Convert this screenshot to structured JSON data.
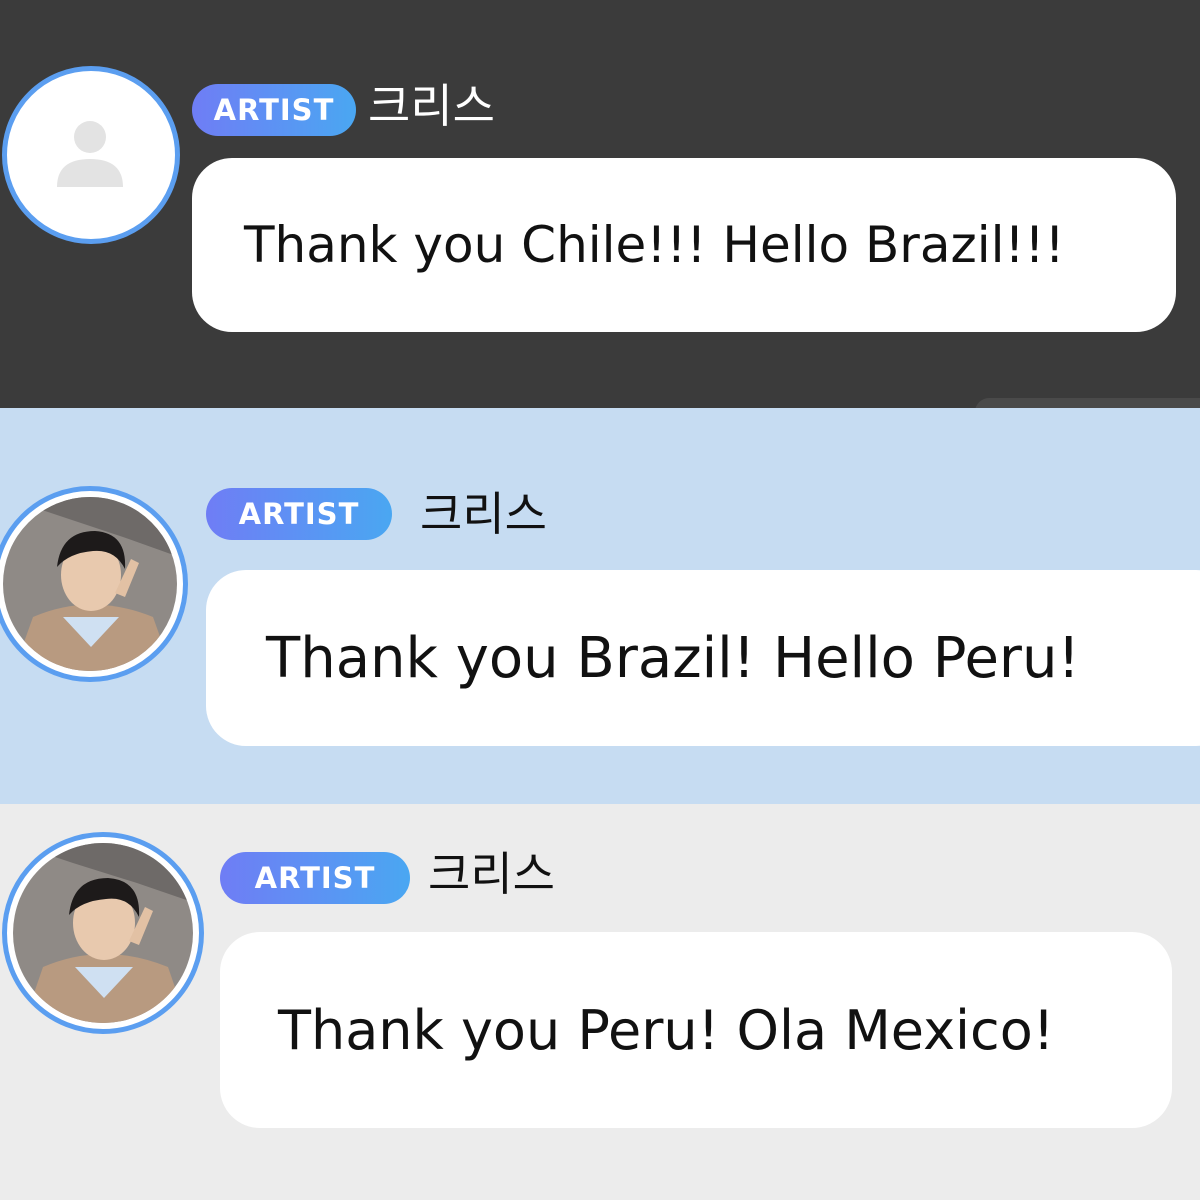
{
  "messages": [
    {
      "badge": "ARTIST",
      "name": "크리스",
      "text": "Thank you Chile!!! Hello Brazil!!!",
      "avatar": "default-person-icon"
    },
    {
      "badge": "ARTIST",
      "name": "크리스",
      "text": "Thank you Brazil! Hello Peru!",
      "avatar": "profile-photo"
    },
    {
      "badge": "ARTIST",
      "name": "크리스",
      "text": "Thank you Peru! Ola Mexico!",
      "avatar": "profile-photo"
    }
  ],
  "colors": {
    "panel_dark": "#3b3b3b",
    "panel_blue": "#c6dcf2",
    "panel_light": "#ececec",
    "badge_gradient_start": "#6f7df5",
    "badge_gradient_end": "#4aa7f2",
    "avatar_ring": "#5b9ef0"
  }
}
